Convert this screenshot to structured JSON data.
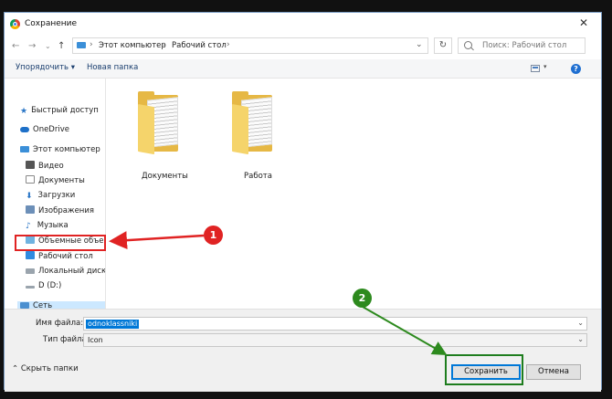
{
  "window": {
    "title": "Сохранение"
  },
  "address": {
    "crumb1": "Этот компьютер",
    "crumb2": "Рабочий стол"
  },
  "search": {
    "placeholder": "Поиск: Рабочий стол"
  },
  "toolbar": {
    "organize": "Упорядочить ▾",
    "new_folder": "Новая папка"
  },
  "sidebar": {
    "items": [
      {
        "label": "Быстрый доступ",
        "icon": "star-icon"
      },
      {
        "label": "OneDrive",
        "icon": "cloud-icon"
      },
      {
        "label": "Этот компьютер",
        "icon": "computer-icon"
      },
      {
        "label": "Видео",
        "icon": "video-icon"
      },
      {
        "label": "Документы",
        "icon": "documents-icon"
      },
      {
        "label": "Загрузки",
        "icon": "download-icon"
      },
      {
        "label": "Изображения",
        "icon": "image-icon"
      },
      {
        "label": "Музыка",
        "icon": "music-icon"
      },
      {
        "label": "Объемные объекты",
        "icon": "cube-icon"
      },
      {
        "label": "Рабочий стол",
        "icon": "desktop-icon"
      },
      {
        "label": "Локальный диск (C",
        "icon": "drive-icon"
      },
      {
        "label": "D (D:)",
        "icon": "drive-icon"
      },
      {
        "label": "Сеть",
        "icon": "network-icon"
      }
    ]
  },
  "content": {
    "folders": [
      {
        "label": "Документы"
      },
      {
        "label": "Работа"
      }
    ]
  },
  "form": {
    "filename_label": "Имя файла:",
    "filename_value": "odnoklassniki",
    "filetype_label": "Тип файла:",
    "filetype_value": "Icon",
    "hide_folders": "Скрыть папки",
    "save": "Сохранить",
    "cancel": "Отмена"
  },
  "annotations": {
    "badge1": "1",
    "badge2": "2",
    "red": "#e02323",
    "green": "#2d8a1e"
  },
  "colors": {
    "selection": "#cce8ff",
    "accent": "#0078d7"
  }
}
